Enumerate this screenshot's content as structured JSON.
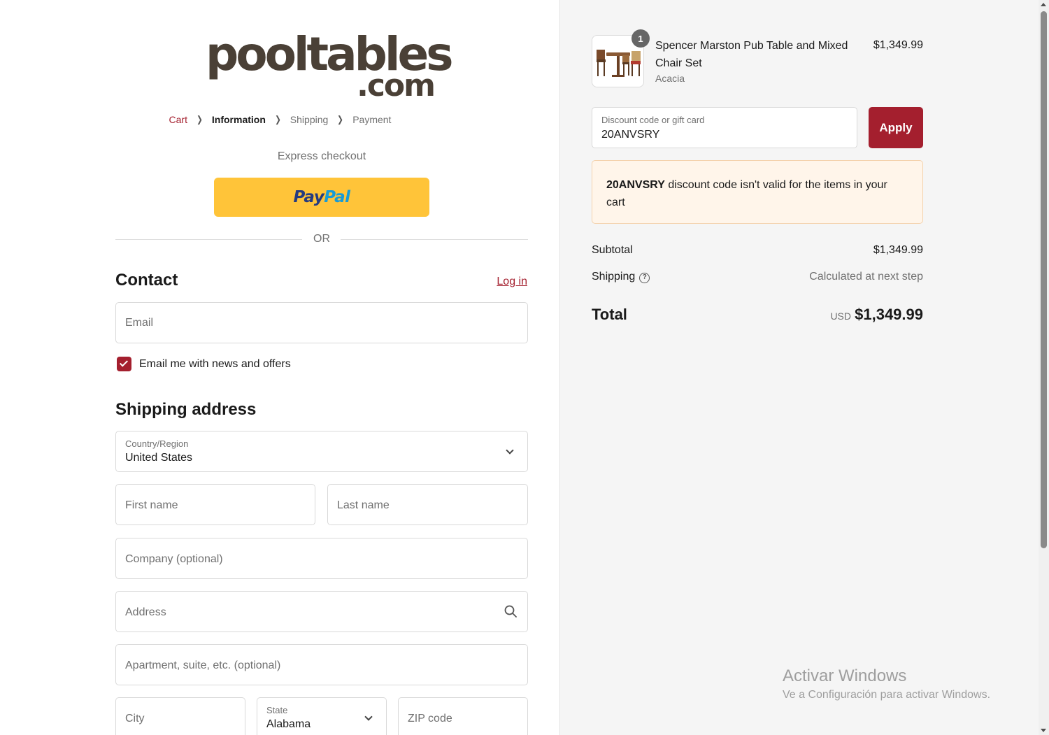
{
  "logo": {
    "text_main": "pooltables",
    "text_domain": ".com"
  },
  "breadcrumb": {
    "items": [
      {
        "label": "Cart",
        "state": "link"
      },
      {
        "label": "Information",
        "state": "current"
      },
      {
        "label": "Shipping",
        "state": "upcoming"
      },
      {
        "label": "Payment",
        "state": "upcoming"
      }
    ],
    "separator_icon": "chevron-right-icon"
  },
  "express": {
    "label": "Express checkout",
    "paypal_part1": "Pay",
    "paypal_part2": "Pal",
    "or_label": "OR"
  },
  "contact": {
    "heading": "Contact",
    "login_label": "Log in",
    "email_placeholder": "Email",
    "newsletter_label": "Email me with news and offers",
    "newsletter_checked": true
  },
  "shipping_address": {
    "heading": "Shipping address",
    "country_label": "Country/Region",
    "country_value": "United States",
    "first_name_placeholder": "First name",
    "last_name_placeholder": "Last name",
    "company_placeholder": "Company (optional)",
    "address_placeholder": "Address",
    "apartment_placeholder": "Apartment, suite, etc. (optional)",
    "city_placeholder": "City",
    "state_label": "State",
    "state_value": "Alabama",
    "zip_placeholder": "ZIP code"
  },
  "order": {
    "item": {
      "quantity": "1",
      "title": "Spencer Marston Pub Table and Mixed Chair Set",
      "variant": "Acacia",
      "price": "$1,349.99"
    },
    "discount": {
      "label": "Discount code or gift card",
      "value": "20ANVSRY",
      "apply_label": "Apply",
      "error_code": "20ANVSRY",
      "error_message": " discount code isn't valid for the items in your cart"
    },
    "subtotal_label": "Subtotal",
    "subtotal_value": "$1,349.99",
    "shipping_label": "Shipping",
    "shipping_value": "Calculated at next step",
    "total_label": "Total",
    "total_currency": "USD",
    "total_value": "$1,349.99"
  },
  "watermark": {
    "title": "Activar Windows",
    "subtitle": "Ve a Configuración para activar Windows."
  },
  "colors": {
    "accent": "#a41f2e",
    "paypal_yellow": "#ffc439",
    "error_bg": "#fff5ea"
  }
}
